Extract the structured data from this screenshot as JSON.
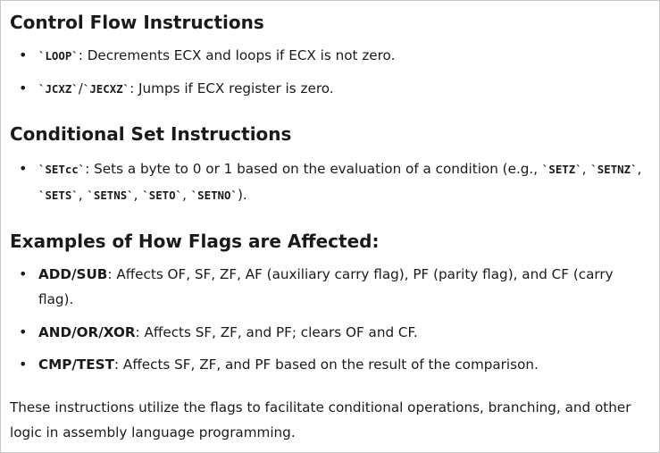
{
  "section_control": {
    "heading": "Control Flow Instructions",
    "items": [
      {
        "code": "`LOOP`",
        "text": ": Decrements ECX and loops if ECX is not zero."
      },
      {
        "code1": "`JCXZ`",
        "sep": "/",
        "code2": "`JECXZ`",
        "text": ": Jumps if ECX register is zero."
      }
    ]
  },
  "section_conditional": {
    "heading": "Conditional Set Instructions",
    "item": {
      "code": "`SETcc`",
      "text": ": Sets a byte to 0 or 1 based on the evaluation of a condition (e.g., ",
      "examples": [
        "`SETZ`",
        "`SETNZ`",
        "`SETS`",
        "`SETNS`",
        "`SETO`",
        "`SETNO`"
      ],
      "sep": ", ",
      "close": ")."
    }
  },
  "section_flags": {
    "heading": "Examples of How Flags are Affected:",
    "items": [
      {
        "term": "ADD/SUB",
        "text": ": Affects OF, SF, ZF, AF (auxiliary carry flag), PF (parity flag), and CF (carry flag)."
      },
      {
        "term": "AND/OR/XOR",
        "text": ": Affects SF, ZF, and PF; clears OF and CF."
      },
      {
        "term": "CMP/TEST",
        "text": ": Affects SF, ZF, and PF based on the result of the comparison."
      }
    ]
  },
  "conclusion": "These instructions utilize the flags to facilitate conditional operations, branching, and other logic in assembly language programming."
}
